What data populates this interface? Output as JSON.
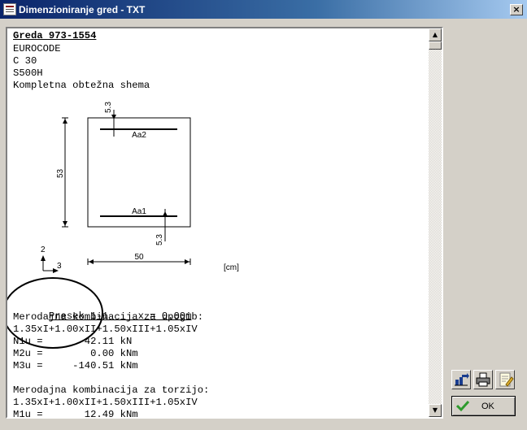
{
  "window": {
    "title": "Dimenzioniranje gred - TXT",
    "close_glyph": "×"
  },
  "report": {
    "heading": "Greda 973-1554",
    "code": "EUROCODE",
    "concrete": "C 30",
    "steel": "S500H",
    "load_scheme": "Kompletna obtežna shema"
  },
  "section_drawing": {
    "top_cover": "5.3",
    "height": "53",
    "top_rebar_label": "Aa2",
    "bottom_rebar_label": "Aa1",
    "bottom_cover": "5.3",
    "width": "50",
    "axis_2": "2",
    "axis_3": "3",
    "unit": "[cm]"
  },
  "results": {
    "section_line": "Presek 1-1     x = 0.00m",
    "bending_title": "Merodajna kombinacija za upogib:",
    "bending_combo": "1.35xI+1.00xII+1.50xIII+1.05xIV",
    "n1u": "N1u =      -42.11 kN",
    "m2u": "M2u =        0.00 kNm",
    "m3u": "M3u =     -140.51 kNm",
    "torsion_title": "Merodajna kombinacija za torzijo:",
    "torsion_combo": "1.35xI+1.00xII+1.50xIII+1.05xIV",
    "m1u_partial": "M1u =       12.49 kNm"
  },
  "buttons": {
    "ok_label": "OK"
  },
  "icons": {
    "app": "report-icon",
    "export": "export-chart-icon",
    "print": "printer-icon",
    "edit": "edit-notepad-icon",
    "ok": "green-check-icon"
  },
  "colors": {
    "titlebar_start": "#0a246a",
    "titlebar_end": "#a6caf0",
    "ok_check": "#2e9b2e"
  }
}
